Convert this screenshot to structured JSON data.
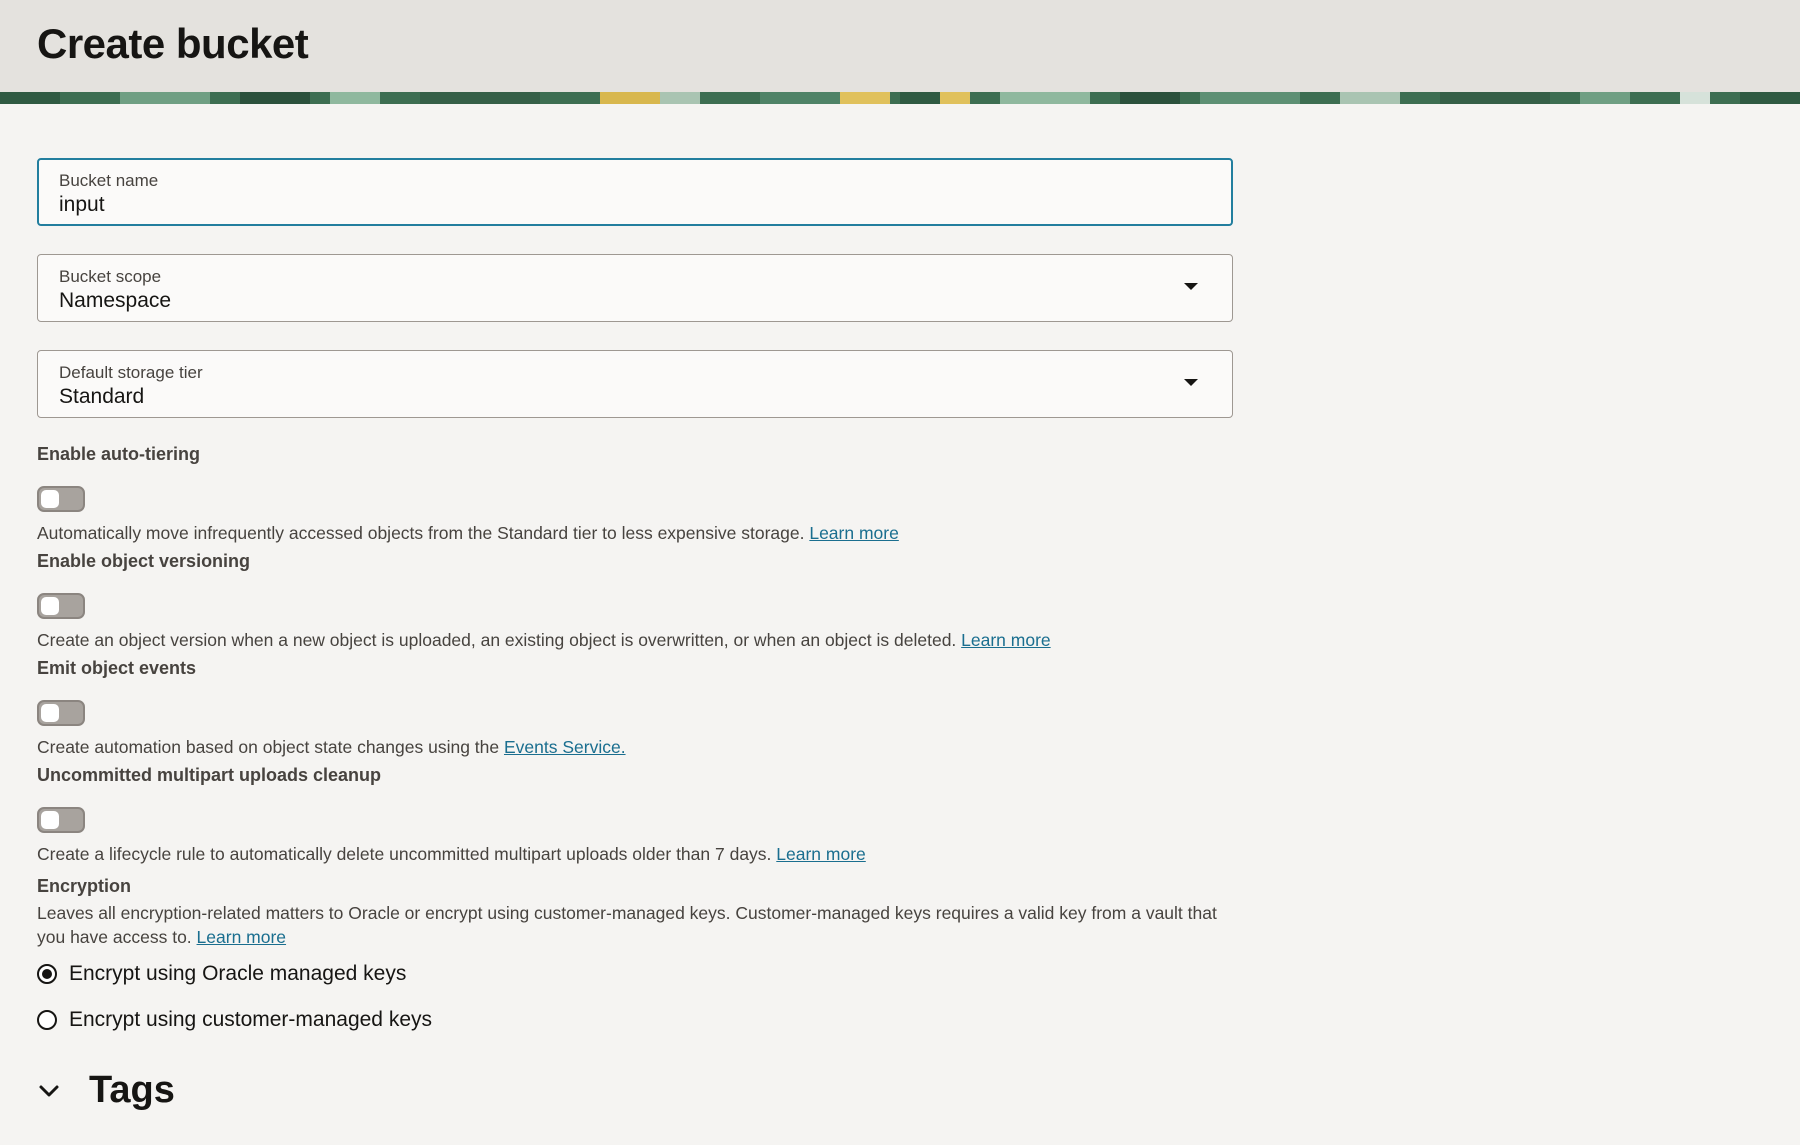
{
  "header": {
    "title": "Create bucket"
  },
  "form": {
    "bucket_name": {
      "label": "Bucket name",
      "value": "input"
    },
    "bucket_scope": {
      "label": "Bucket scope",
      "value": "Namespace"
    },
    "storage_tier": {
      "label": "Default storage tier",
      "value": "Standard"
    }
  },
  "toggles": {
    "auto_tiering": {
      "label": "Enable auto-tiering",
      "help": "Automatically move infrequently accessed objects from the Standard tier to less expensive storage. ",
      "link": "Learn more",
      "enabled": false
    },
    "versioning": {
      "label": "Enable object versioning",
      "help": "Create an object version when a new object is uploaded, an existing object is overwritten, or when an object is deleted. ",
      "link": "Learn more",
      "enabled": false
    },
    "events": {
      "label": "Emit object events",
      "help": "Create automation based on object state changes using the ",
      "link": "Events Service.",
      "enabled": false
    },
    "multipart_cleanup": {
      "label": "Uncommitted multipart uploads cleanup",
      "help": "Create a lifecycle rule to automatically delete uncommitted multipart uploads older than 7 days. ",
      "link": "Learn more",
      "enabled": false
    }
  },
  "encryption": {
    "label": "Encryption",
    "description": "Leaves all encryption-related matters to Oracle or encrypt using customer-managed keys. Customer-managed keys requires a valid key from a vault that you have access to. ",
    "link": "Learn more",
    "options": [
      {
        "label": "Encrypt using Oracle managed keys",
        "selected": true
      },
      {
        "label": "Encrypt using customer-managed keys",
        "selected": false
      }
    ]
  },
  "tags": {
    "title": "Tags"
  },
  "colors": {
    "accent": "#227e9e",
    "link": "#1a6e8f",
    "background": "#f5f4f2",
    "header_background": "#e4e2de"
  }
}
